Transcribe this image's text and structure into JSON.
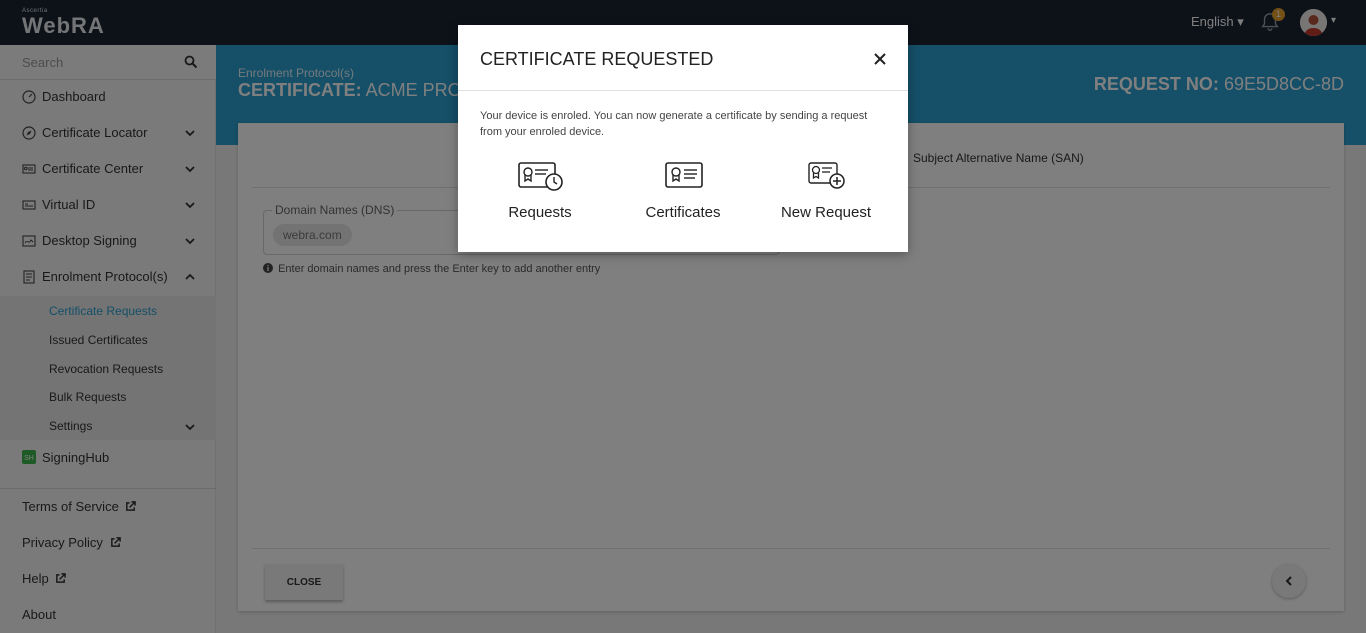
{
  "topbar": {
    "logo_small": "Ascertia",
    "logo_main": "WebRA",
    "language": "English ▾",
    "notification_count": "1",
    "avatar_caret": "▾"
  },
  "sidebar": {
    "search_placeholder": "Search",
    "items": [
      {
        "label": "Dashboard",
        "icon": "dashboard-icon"
      },
      {
        "label": "Certificate Locator",
        "icon": "compass-icon"
      },
      {
        "label": "Certificate Center",
        "icon": "certificate-icon"
      },
      {
        "label": "Virtual ID",
        "icon": "id-card-icon"
      },
      {
        "label": "Desktop Signing",
        "icon": "signing-icon"
      },
      {
        "label": "Enrolment Protocol(s)",
        "icon": "protocol-icon"
      }
    ],
    "submenu": [
      {
        "label": "Certificate Requests"
      },
      {
        "label": "Issued Certificates"
      },
      {
        "label": "Revocation Requests"
      },
      {
        "label": "Bulk Requests"
      },
      {
        "label": "Settings"
      }
    ],
    "signinghub": "SigningHub",
    "footer": [
      {
        "label": "Terms of Service"
      },
      {
        "label": "Privacy Policy"
      },
      {
        "label": "Help"
      },
      {
        "label": "About"
      }
    ]
  },
  "banner": {
    "breadcrumb": "Enrolment Protocol(s)",
    "title_prefix": "CERTIFICATE:",
    "title_value": "ACME PROFI",
    "request_prefix": "REQUEST NO:",
    "request_value": "69E5D8CC-8D"
  },
  "card": {
    "san_title": "Subject Alternative Name (SAN)",
    "field_label": "Domain Names (DNS)",
    "chip_value": "webra.com",
    "hint": "Enter domain names and press the Enter key to add another entry",
    "close_label": "CLOSE"
  },
  "modal": {
    "title": "CERTIFICATE REQUESTED",
    "message": "Your device is enroled. You can now generate a certificate by sending a request from your enroled device.",
    "options": [
      {
        "label": "Requests",
        "icon": "certificate-clock-icon"
      },
      {
        "label": "Certificates",
        "icon": "certificate-icon"
      },
      {
        "label": "New Request",
        "icon": "certificate-add-icon"
      }
    ]
  },
  "colors": {
    "topbar": "#1b2533",
    "accent": "#2b9fd0",
    "badge": "#e6a02b"
  }
}
